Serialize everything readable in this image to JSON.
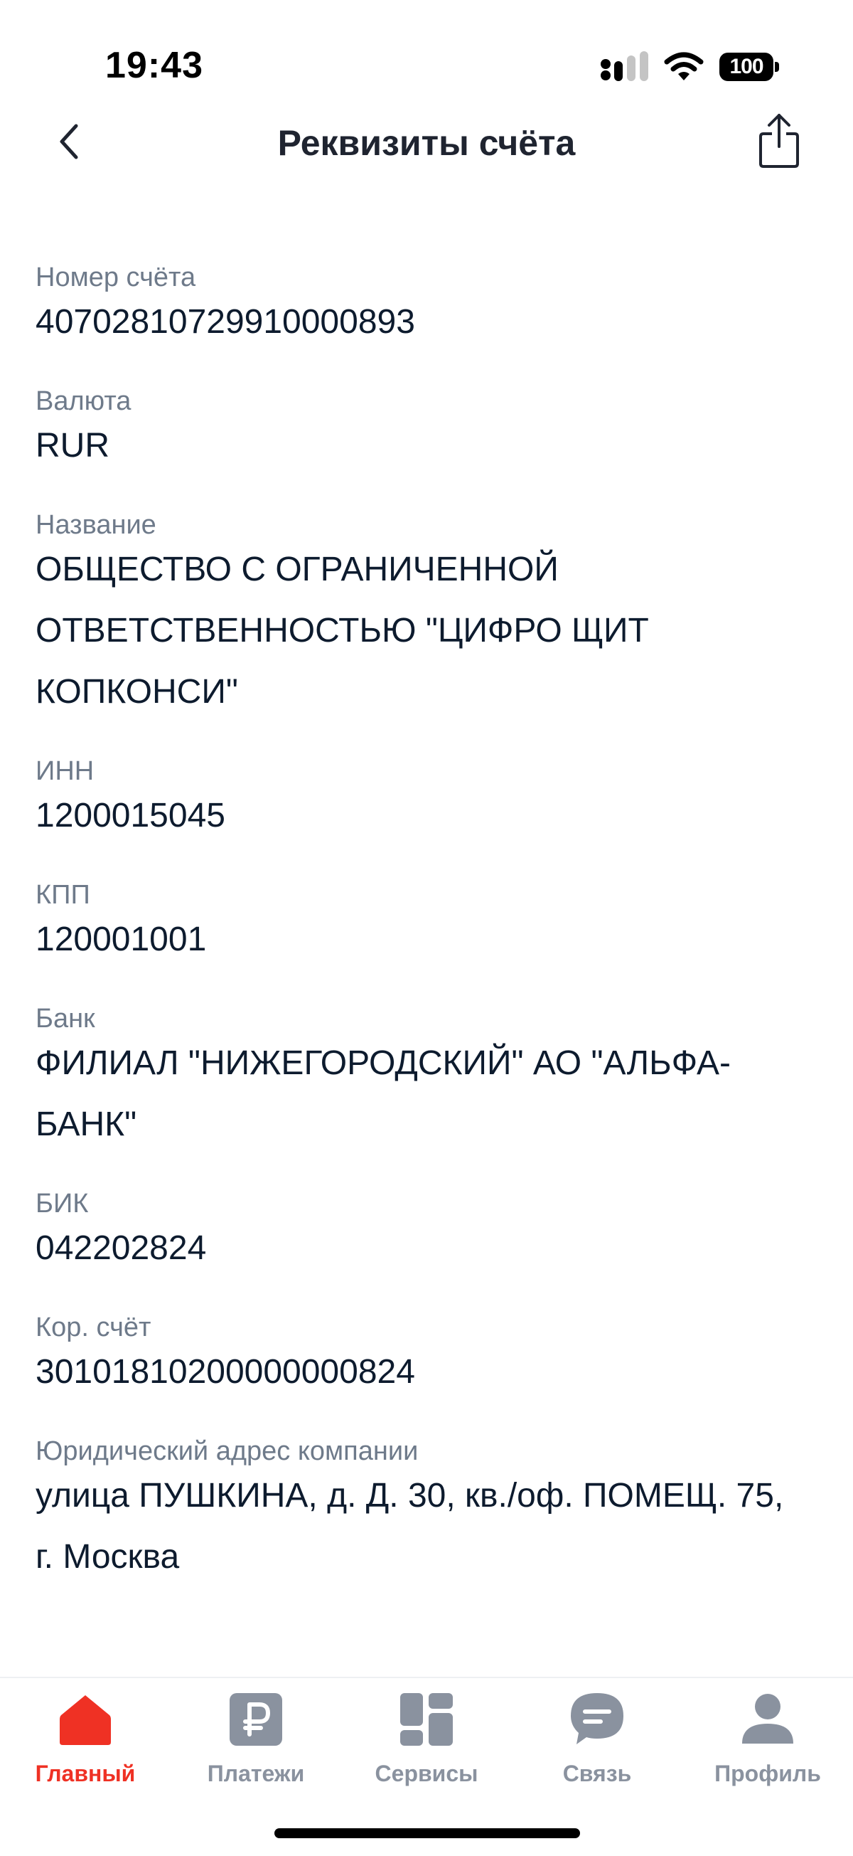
{
  "status_bar": {
    "time": "19:43",
    "battery": "100",
    "icons": [
      "signal-icon",
      "wifi-icon",
      "battery-icon"
    ]
  },
  "header": {
    "title": "Реквизиты счёта",
    "back_icon": "chevron-left-icon",
    "share_icon": "share-icon"
  },
  "fields": [
    {
      "label": "Номер счёта",
      "value": "40702810729910000893"
    },
    {
      "label": "Валюта",
      "value": "RUR"
    },
    {
      "label": "Название",
      "value": "ОБЩЕСТВО С ОГРАНИЧЕННОЙ ОТВЕТСТВЕННОСТЬЮ \"ЦИФРО ЩИТ КОПКОНСИ\""
    },
    {
      "label": "ИНН",
      "value": "1200015045"
    },
    {
      "label": "КПП",
      "value": "120001001"
    },
    {
      "label": "Банк",
      "value": "ФИЛИАЛ \"НИЖЕГОРОДСКИЙ\" АО \"АЛЬФА-БАНК\""
    },
    {
      "label": "БИК",
      "value": "042202824"
    },
    {
      "label": "Кор. счёт",
      "value": "30101810200000000824"
    },
    {
      "label": "Юридический адрес компании",
      "value": "улица ПУШКИНА, д. Д. 30, кв./оф. ПОМЕЩ. 75, г. Москва"
    }
  ],
  "tab_bar": {
    "items": [
      {
        "label": "Главный",
        "icon": "home-icon",
        "active": true
      },
      {
        "label": "Платежи",
        "icon": "ruble-icon",
        "active": false
      },
      {
        "label": "Сервисы",
        "icon": "grid-icon",
        "active": false
      },
      {
        "label": "Связь",
        "icon": "chat-icon",
        "active": false
      },
      {
        "label": "Профиль",
        "icon": "profile-icon",
        "active": false
      }
    ]
  },
  "colors": {
    "accent": "#ef3124",
    "text_primary": "#0d1b2e",
    "text_secondary": "#6e7a8a",
    "tab_inactive": "#8a929f"
  }
}
